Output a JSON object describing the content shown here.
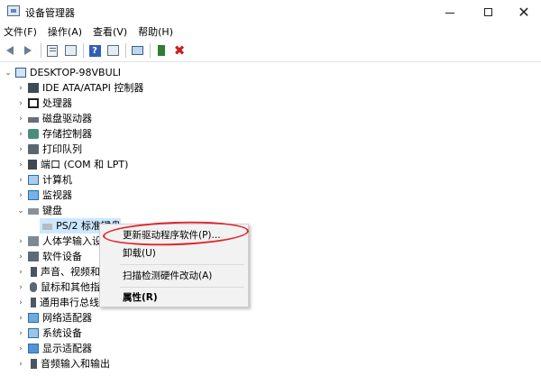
{
  "window": {
    "title": "设备管理器",
    "controls": {
      "minimize": "—",
      "maximize": "□",
      "close": "✕"
    }
  },
  "menubar": {
    "items": [
      "文件(F)",
      "操作(A)",
      "查看(V)",
      "帮助(H)"
    ]
  },
  "toolbar": {
    "icons": [
      "back-arrow-icon",
      "forward-arrow-icon",
      "properties-sheet-icon",
      "details-sheet-icon",
      "help-icon",
      "view-grid-icon",
      "monitor-icon",
      "update-driver-icon",
      "uninstall-x-icon"
    ]
  },
  "tree": {
    "root": "DESKTOP-98VBULI",
    "categories": [
      "IDE ATA/ATAPI 控制器",
      "处理器",
      "磁盘驱动器",
      "存储控制器",
      "打印队列",
      "端口 (COM 和 LPT)",
      "计算机",
      "监视器",
      "键盘",
      "PS/2 标准键盘",
      "人体学输入设",
      "软件设备",
      "声音、视频和",
      "鼠标和其他指",
      "通用串行总线",
      "网络适配器",
      "系统设备",
      "显示适配器",
      "音频输入和输出"
    ]
  },
  "context_menu": {
    "items": [
      "更新驱动程序软件(P)...",
      "卸载(U)",
      "扫描检测硬件改动(A)",
      "属性(R)"
    ]
  },
  "colors": {
    "annotation": "#e0232d",
    "context_menu_bg": "#f2f2f2",
    "selection": "#cce8ff"
  }
}
